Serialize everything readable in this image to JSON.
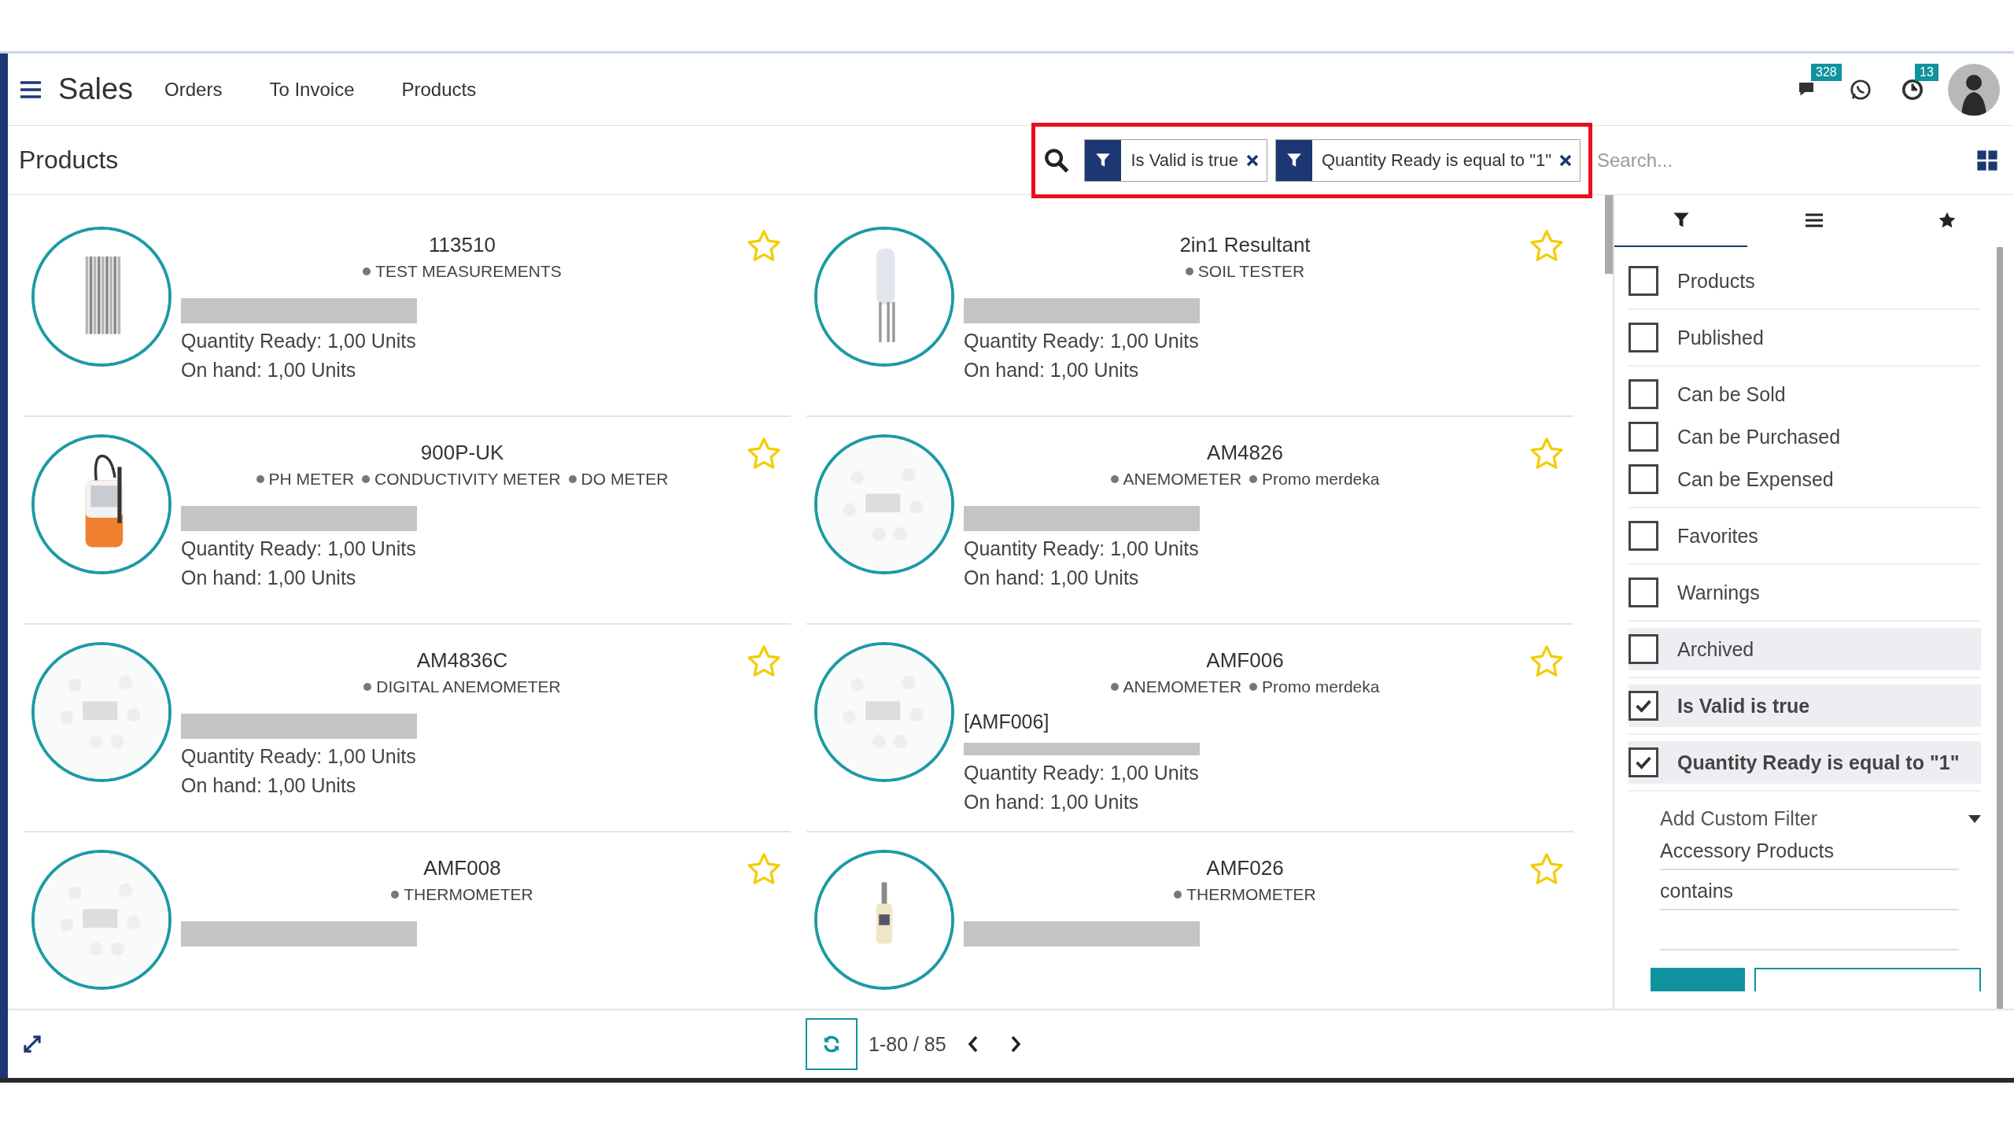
{
  "navbar": {
    "app_title": "Sales",
    "menu": [
      {
        "label": "Orders"
      },
      {
        "label": "To Invoice"
      },
      {
        "label": "Products"
      }
    ],
    "systray": [
      {
        "kind": "chat",
        "count": "328"
      },
      {
        "kind": "whatsapp"
      },
      {
        "kind": "activity",
        "count": "13"
      },
      {
        "kind": "avatar"
      }
    ]
  },
  "control_panel": {
    "breadcrumb": "Products",
    "facets": [
      {
        "label": "Is Valid is true"
      },
      {
        "label": "Quantity Ready is equal to \"1\""
      }
    ],
    "search": {
      "placeholder": "Search..."
    }
  },
  "products": [
    {
      "name": "113510",
      "tags": [
        "TEST MEASUREMENTS"
      ],
      "favorite": false,
      "quantity_ready": "Quantity Ready: 1,00 Units",
      "on_hand": "On hand: 1,00 Units"
    },
    {
      "name": "2in1 Resultant",
      "tags": [
        "SOIL TESTER"
      ],
      "favorite": false,
      "quantity_ready": "Quantity Ready: 1,00 Units",
      "on_hand": "On hand: 1,00 Units"
    },
    {
      "name": "900P-UK",
      "tags": [
        "PH METER",
        "CONDUCTIVITY METER",
        "DO METER"
      ],
      "favorite": false,
      "quantity_ready": "Quantity Ready: 1,00 Units",
      "on_hand": "On hand: 1,00 Units"
    },
    {
      "name": "AM4826",
      "tags": [
        "ANEMOMETER",
        "Promo merdeka"
      ],
      "favorite": false,
      "quantity_ready": "Quantity Ready: 1,00 Units",
      "on_hand": "On hand: 1,00 Units"
    },
    {
      "name": "AM4836C",
      "tags": [
        "DIGITAL ANEMOMETER"
      ],
      "favorite": false,
      "quantity_ready": "Quantity Ready: 1,00 Units",
      "on_hand": "On hand: 1,00 Units"
    },
    {
      "name": "AMF006",
      "tags": [
        "ANEMOMETER",
        "Promo merdeka"
      ],
      "reference": "[AMF006]",
      "favorite": false,
      "quantity_ready": "Quantity Ready: 1,00 Units",
      "on_hand": "On hand: 1,00 Units"
    },
    {
      "name": "AMF008",
      "tags": [
        "THERMOMETER"
      ],
      "favorite": false
    },
    {
      "name": "AMF026",
      "tags": [
        "THERMOMETER"
      ],
      "favorite": false
    }
  ],
  "filter_panel": {
    "tabs": [
      {
        "selected": true
      },
      {
        "selected": false
      },
      {
        "selected": false
      }
    ],
    "groups": [
      [
        {
          "label": "Products",
          "checked": false
        }
      ],
      [
        {
          "label": "Published",
          "checked": false
        }
      ],
      [
        {
          "label": "Can be Sold",
          "checked": false
        },
        {
          "label": "Can be Purchased",
          "checked": false
        },
        {
          "label": "Can be Expensed",
          "checked": false
        }
      ],
      [
        {
          "label": "Favorites",
          "checked": false
        }
      ],
      [
        {
          "label": "Warnings",
          "checked": false
        }
      ],
      [
        {
          "label": "Archived",
          "checked": false,
          "highlighted": true
        }
      ],
      [
        {
          "label": "Is Valid is true",
          "checked": true
        }
      ],
      [
        {
          "label": "Quantity Ready is equal to \"1\"",
          "checked": true
        }
      ]
    ],
    "custom_filter": {
      "label": "Add Custom Filter",
      "field": "Accessory Products",
      "operator": "contains"
    }
  },
  "pager": {
    "range": "1-80 / 85"
  }
}
